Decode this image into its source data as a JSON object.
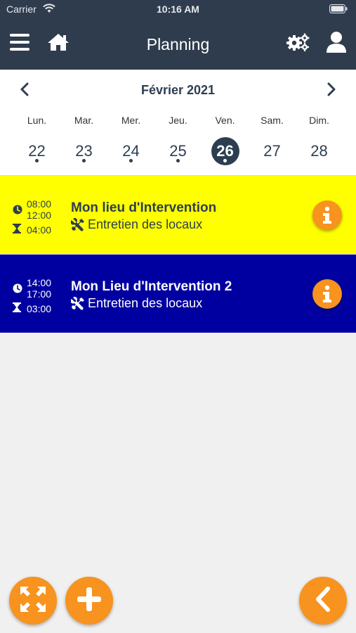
{
  "status_bar": {
    "carrier": "Carrier",
    "time": "10:16 AM"
  },
  "header": {
    "title": "Planning"
  },
  "calendar": {
    "month": "Février 2021",
    "days": [
      {
        "name": "Lun.",
        "num": "22",
        "dot": true,
        "selected": false
      },
      {
        "name": "Mar.",
        "num": "23",
        "dot": true,
        "selected": false
      },
      {
        "name": "Mer.",
        "num": "24",
        "dot": true,
        "selected": false
      },
      {
        "name": "Jeu.",
        "num": "25",
        "dot": true,
        "selected": false
      },
      {
        "name": "Ven.",
        "num": "26",
        "dot": true,
        "selected": true
      },
      {
        "name": "Sam.",
        "num": "27",
        "dot": false,
        "selected": false
      },
      {
        "name": "Dim.",
        "num": "28",
        "dot": false,
        "selected": false
      }
    ]
  },
  "events": [
    {
      "start": "08:00",
      "end": "12:00",
      "duration": "04:00",
      "title": "Mon lieu d'Intervention",
      "task": "Entretien des locaux",
      "bg_color": "#ffff00",
      "text_color": "#2d3e50"
    },
    {
      "start": "14:00",
      "end": "17:00",
      "duration": "03:00",
      "title": "Mon Lieu d'Intervention 2",
      "task": "Entretien des locaux",
      "bg_color": "#0000a0",
      "text_color": "#ffffff"
    }
  ],
  "colors": {
    "header_bg": "#2f3c4e",
    "accent": "#f7931e"
  },
  "icons": {
    "menu": "menu-icon",
    "home": "home-icon",
    "settings": "gears-icon",
    "user": "user-icon",
    "prev": "chevron-left-icon",
    "next": "chevron-right-icon",
    "clock": "clock-icon",
    "duration": "hourglass-icon",
    "task": "tools-icon",
    "info": "info-icon",
    "expand": "expand-icon",
    "add": "plus-icon",
    "back": "chevron-left-icon"
  }
}
